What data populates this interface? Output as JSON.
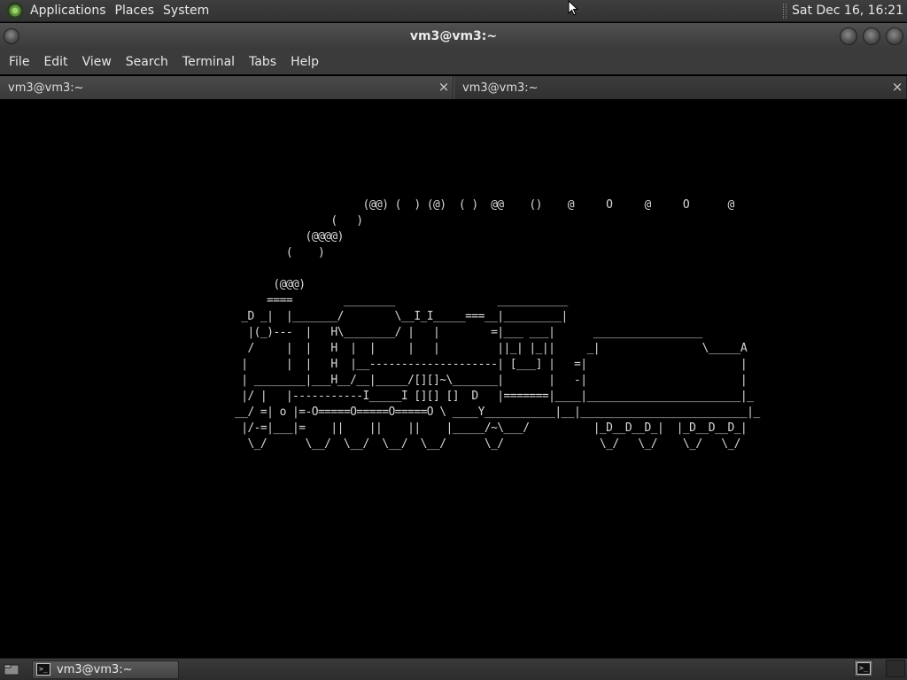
{
  "top_panel": {
    "menus": [
      "Applications",
      "Places",
      "System"
    ],
    "clock": "Sat Dec 16, 16:21"
  },
  "window": {
    "title": "vm3@vm3:~"
  },
  "menubar": {
    "items": [
      "File",
      "Edit",
      "View",
      "Search",
      "Terminal",
      "Tabs",
      "Help"
    ]
  },
  "tabs": [
    {
      "label": "vm3@vm3:~",
      "close": "×"
    },
    {
      "label": "vm3@vm3:~",
      "close": "×"
    }
  ],
  "terminal": {
    "content": "                    (@@) (  ) (@)  ( )  @@    ()    @     O     @     O      @\n               (   )\n           (@@@@)\n        (    )\n\n      (@@@)\n     ====        ________                ___________\n _D _|  |_______/        \\__I_I_____===__|_________|\n  |(_)---  |   H\\________/ |   |        =|___ ___|      _________________\n  /     |  |   H  |  |     |   |         ||_| |_||     _|                \\_____A\n |      |  |   H  |__--------------------| [___] |   =|                        |\n | ________|___H__/__|_____/[][]~\\_______|       |   -|                        |\n |/ |   |-----------I_____I [][] []  D   |=======|____|________________________|_\n__/ =| o |=-O=====O=====O=====O \\ ____Y___________|__|__________________________|_\n |/-=|___|=    ||    ||    ||    |_____/~\\___/          |_D__D__D_|  |_D__D__D_|\n  \\_/      \\__/  \\__/  \\__/  \\__/      \\_/               \\_/   \\_/    \\_/   \\_/"
  },
  "bottom_panel": {
    "task": "vm3@vm3:~"
  }
}
